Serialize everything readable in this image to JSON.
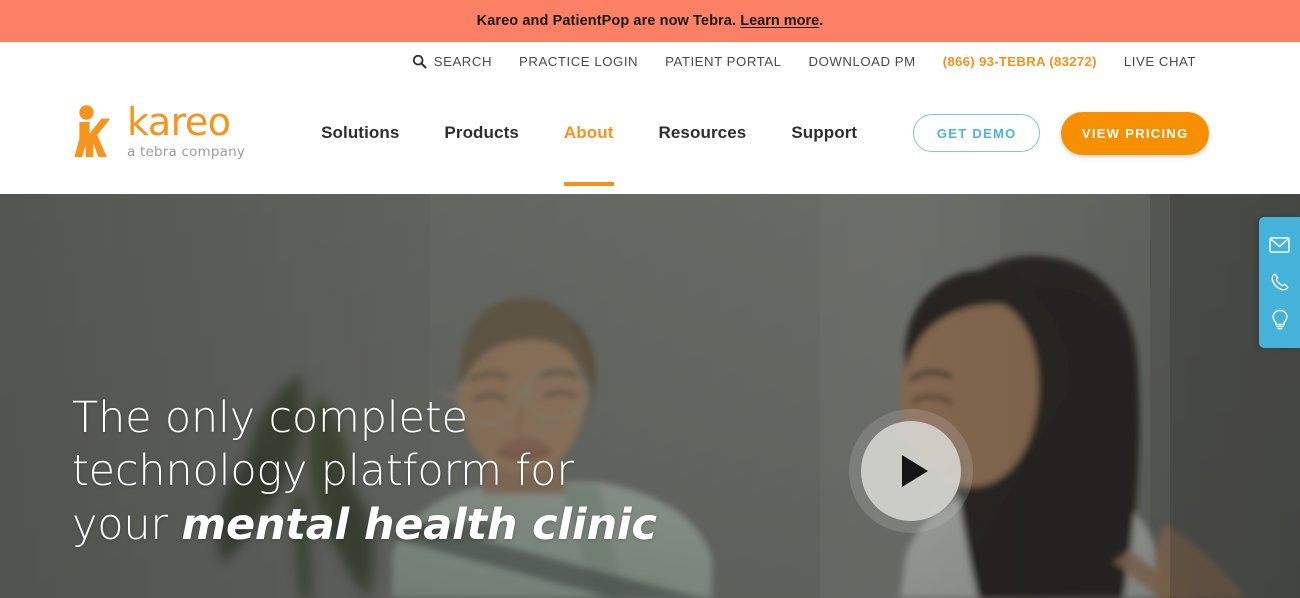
{
  "announcement": {
    "text_before": "Kareo and PatientPop are now Tebra. ",
    "link_label": "Learn more",
    "text_after": ".",
    "background": "#fc8164"
  },
  "utility_nav": {
    "search_label": "SEARCH",
    "search_icon": "search-icon",
    "items": [
      {
        "label": "PRACTICE LOGIN"
      },
      {
        "label": "PATIENT PORTAL"
      },
      {
        "label": "DOWNLOAD PM"
      }
    ],
    "phone": "(866) 93-TEBRA (83272)",
    "phone_color": "#f6911e",
    "live_chat": "LIVE CHAT"
  },
  "logo": {
    "wordmark": "kareo",
    "tagline": "a tebra company",
    "mark_icon": "kareo-k-figure-icon",
    "brand_color": "#f7941e",
    "tagline_color": "#9d9d9d"
  },
  "primary_nav": {
    "items": [
      {
        "label": "Solutions",
        "active": false
      },
      {
        "label": "Products",
        "active": false
      },
      {
        "label": "About",
        "active": true
      },
      {
        "label": "Resources",
        "active": false
      },
      {
        "label": "Support",
        "active": false
      }
    ],
    "active_color": "#f6911e"
  },
  "cta": {
    "demo_label": "GET DEMO",
    "demo_border_color": "#77c7e6",
    "demo_text_color": "#4fb3dd",
    "pricing_label": "VIEW PRICING",
    "pricing_background": "#f79000",
    "pricing_text_color": "#ffffff"
  },
  "hero": {
    "headline_line1": "The only complete",
    "headline_line2": "technology platform for",
    "headline_line3_prefix": "your ",
    "headline_line3_emphasis": "mental health clinic",
    "play_button_icon": "play-icon",
    "image_description": "two-clinicians-conversation-photo"
  },
  "side_tab": {
    "background": "#45b3d9",
    "icons": [
      {
        "name": "envelope-icon"
      },
      {
        "name": "phone-icon"
      },
      {
        "name": "lightbulb-icon"
      }
    ]
  }
}
